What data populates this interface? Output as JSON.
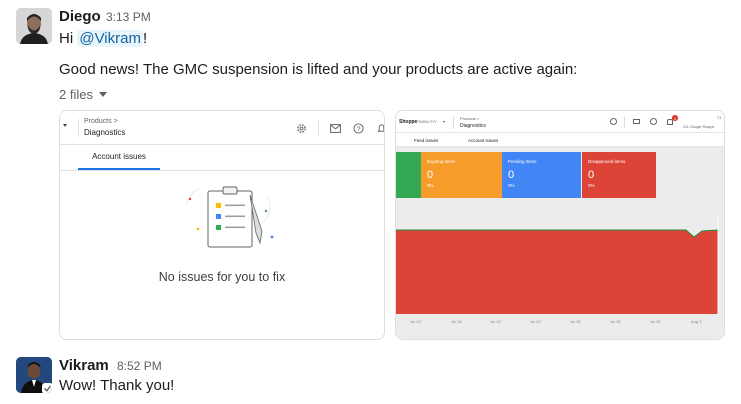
{
  "messages": [
    {
      "author": "Diego",
      "time": "3:13 PM",
      "greeting_prefix": "Hi ",
      "mention": "@Vikram",
      "greeting_suffix": "!",
      "body": "Good news! The GMC suspension is lifted and your products are active again:",
      "files_label": "2 files"
    },
    {
      "author": "Vikram",
      "time": "8:52 PM",
      "body": "Wow! Thank you!"
    }
  ],
  "attachment1": {
    "breadcrumb": "Products >",
    "title": "Diagnostics",
    "tab": "Account issues",
    "empty_text": "No issues for you to fix"
  },
  "attachment2": {
    "store": "Shoppe",
    "store_id": "794004-YYY",
    "breadcrumb": "Products >",
    "title": "Diagnostics",
    "tabs": [
      "Feed issues",
      "Account issues"
    ],
    "account_line1": "71",
    "account_line2": "CJL Google Shoppe",
    "notification_count": "3",
    "cards": [
      {
        "label": "Expiring items",
        "value": "0",
        "pct": "0%",
        "color": "#f59c2a"
      },
      {
        "label": "Pending items",
        "value": "0",
        "pct": "0%",
        "color": "#4285f4"
      },
      {
        "label": "Disapproved items",
        "value": "0",
        "pct": "0%",
        "color": "#db4437"
      }
    ],
    "x_axis": [
      "Jul 13",
      "Jul 16",
      "Jul 19",
      "Jul 22",
      "Jul 25",
      "Jul 28",
      "Jul 31",
      "Aug 3"
    ]
  },
  "colors": {
    "active_green": "#34a853",
    "disapproved_red": "#db4437",
    "mention_bg": "#e8f5fa",
    "mention_fg": "#1264a3"
  }
}
